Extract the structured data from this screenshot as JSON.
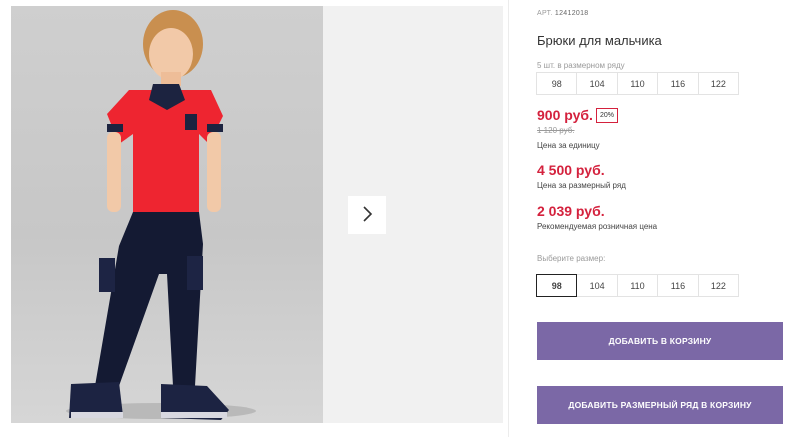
{
  "product": {
    "art_label": "АРТ.",
    "art_number": "12412018",
    "title": "Брюки для мальчика",
    "pack_note": "5 шт. в размерном ряду"
  },
  "size_row": [
    "98",
    "104",
    "110",
    "116",
    "122"
  ],
  "pricing": {
    "unit_price": "900 руб.",
    "discount_badge": "20%",
    "old_price": "1 120 руб.",
    "unit_label": "Цена за единицу",
    "pack_price": "4 500 руб.",
    "pack_label": "Цена за размерный ряд",
    "rrp_price": "2 039 руб.",
    "rrp_label": "Рекомендуемая розничная цена"
  },
  "size_select": {
    "label": "Выберите размер:",
    "options": [
      "98",
      "104",
      "110",
      "116",
      "122"
    ],
    "selected": "98"
  },
  "actions": {
    "add_to_cart": "ДОБАВИТЬ В КОРЗИНУ",
    "add_pack_to_cart": "ДОБАВИТЬ РАЗМЕРНЫЙ РЯД В КОРЗИНУ"
  },
  "gallery": {
    "next_icon": "chevron-right-icon"
  },
  "colors": {
    "accent_price": "#d4213d",
    "button": "#7b68a6"
  }
}
